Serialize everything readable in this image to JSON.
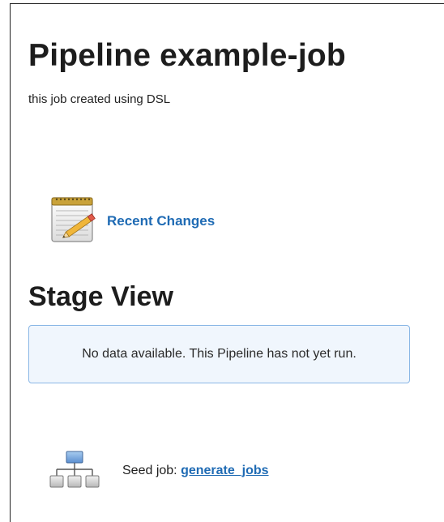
{
  "job": {
    "title": "Pipeline example-job",
    "description": "this job created using DSL"
  },
  "links": {
    "recent_changes": "Recent Changes",
    "recent_changes_icon": "notepad-icon"
  },
  "stage_view": {
    "heading": "Stage View",
    "empty_message": "No data available. This Pipeline has not yet run."
  },
  "seed_job": {
    "label": "Seed job:",
    "link_text": "generate_jobs",
    "icon": "hierarchy-icon"
  },
  "colors": {
    "link": "#1f6bb4",
    "info_box_bg": "#f0f6fd",
    "info_box_border": "#8ab7e6"
  }
}
